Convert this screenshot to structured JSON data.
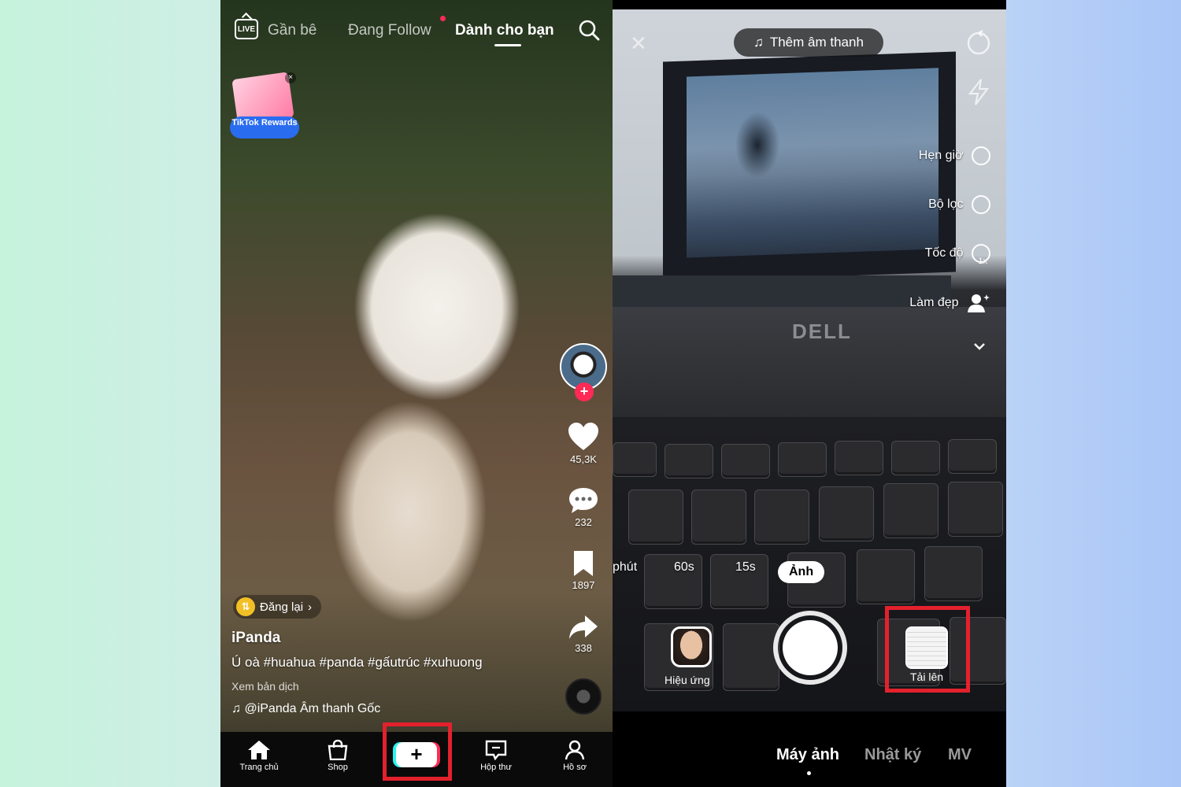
{
  "feed": {
    "live_label": "LIVE",
    "tabs": [
      {
        "label": "Gần bê"
      },
      {
        "label": "Đang Follow"
      },
      {
        "label": "Dành cho bạn"
      }
    ],
    "rewards": {
      "label": "TikTok Rewards"
    },
    "rail": {
      "likes": "45,3K",
      "comments": "232",
      "saves": "1897",
      "shares": "338"
    },
    "repost": {
      "label": "Đăng lại"
    },
    "author": "iPanda",
    "caption": "Ú oà #huahua #panda #gấutrúc #xuhuong",
    "translate": "Xem bản dịch",
    "sound": "@iPanda Âm thanh Gốc",
    "nav": [
      {
        "label": "Trang chủ"
      },
      {
        "label": "Shop"
      },
      {
        "label": "+"
      },
      {
        "label": "Hộp thư"
      },
      {
        "label": "Hồ sơ"
      }
    ]
  },
  "camera": {
    "add_sound": "Thêm âm thanh",
    "side": [
      {
        "label": "Hẹn giờ"
      },
      {
        "label": "Bộ lọc"
      },
      {
        "label": "Tốc độ"
      },
      {
        "label": "Làm đẹp"
      }
    ],
    "speed_value": "1x",
    "brand": "DELL",
    "modes": [
      {
        "label": "phút"
      },
      {
        "label": "60s"
      },
      {
        "label": "15s"
      },
      {
        "label": "Ảnh"
      }
    ],
    "effects_label": "Hiệu ứng",
    "upload_label": "Tải lên",
    "bottom_tabs": [
      {
        "label": "Máy ảnh"
      },
      {
        "label": "Nhật ký"
      },
      {
        "label": "MV"
      }
    ]
  },
  "colors": {
    "highlight": "#e3212d",
    "accent": "#fe2c55",
    "accent2": "#25f4ee"
  }
}
